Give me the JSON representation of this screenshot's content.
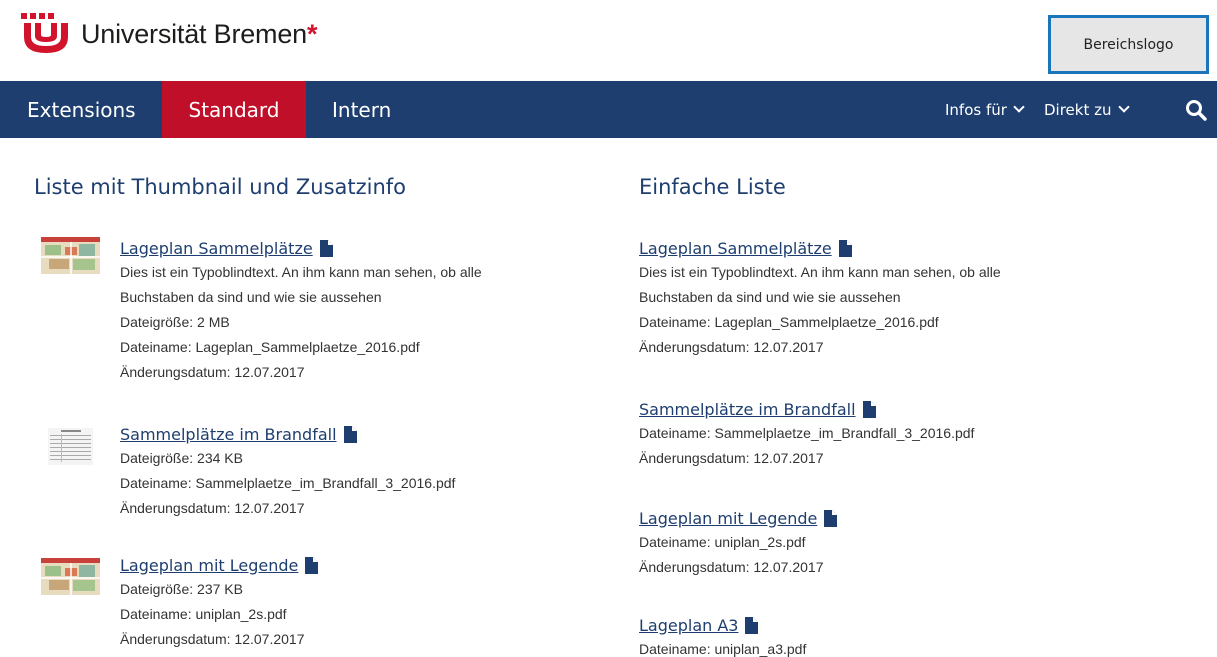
{
  "header": {
    "logo_text": "Universität Bremen",
    "logo_star": "*",
    "bereichslogo": "Bereichslogo"
  },
  "nav": {
    "items": [
      {
        "label": "Extensions"
      },
      {
        "label": "Standard"
      },
      {
        "label": "Intern"
      }
    ],
    "infos_label": "Infos für",
    "direkt_label": "Direkt zu"
  },
  "left": {
    "title": "Liste mit Thumbnail und Zusatzinfo",
    "items": [
      {
        "link": "Lageplan Sammelplätze",
        "lines": [
          "Dies ist ein Typoblindtext. An ihm kann man sehen, ob alle",
          "Buchstaben da sind und wie sie aussehen",
          "Dateigröße: 2 MB",
          "Dateiname: Lageplan_Sammelplaetze_2016.pdf",
          "Änderungsdatum: 12.07.2017"
        ]
      },
      {
        "link": "Sammelplätze im Brandfall",
        "lines": [
          "Dateigröße: 234 KB",
          "Dateiname: Sammelplaetze_im_Brandfall_3_2016.pdf",
          "Änderungsdatum: 12.07.2017"
        ]
      },
      {
        "link": "Lageplan mit Legende",
        "lines": [
          "Dateigröße: 237 KB",
          "Dateiname: uniplan_2s.pdf",
          "Änderungsdatum: 12.07.2017"
        ]
      }
    ]
  },
  "right": {
    "title": "Einfache Liste",
    "items": [
      {
        "link": "Lageplan Sammelplätze",
        "lines": [
          "Dies ist ein Typoblindtext. An ihm kann man sehen, ob alle",
          "Buchstaben da sind und wie sie aussehen",
          "Dateiname: Lageplan_Sammelplaetze_2016.pdf",
          "Änderungsdatum: 12.07.2017"
        ]
      },
      {
        "link": "Sammelplätze im Brandfall",
        "lines": [
          "Dateiname: Sammelplaetze_im_Brandfall_3_2016.pdf",
          "Änderungsdatum: 12.07.2017"
        ]
      },
      {
        "link": "Lageplan mit Legende",
        "lines": [
          "Dateiname: uniplan_2s.pdf",
          "Änderungsdatum: 12.07.2017"
        ]
      },
      {
        "link": "Lageplan A3",
        "lines": [
          "Dateiname: uniplan_a3.pdf"
        ]
      }
    ]
  },
  "colors": {
    "nav_bg": "#1e3e6f",
    "active_tab": "#bf0f29",
    "brand_red": "#d1142c",
    "link": "#1e3e6f"
  },
  "icons": [
    "university-logo-icon",
    "chevron-down-icon",
    "search-icon",
    "file-icon"
  ]
}
